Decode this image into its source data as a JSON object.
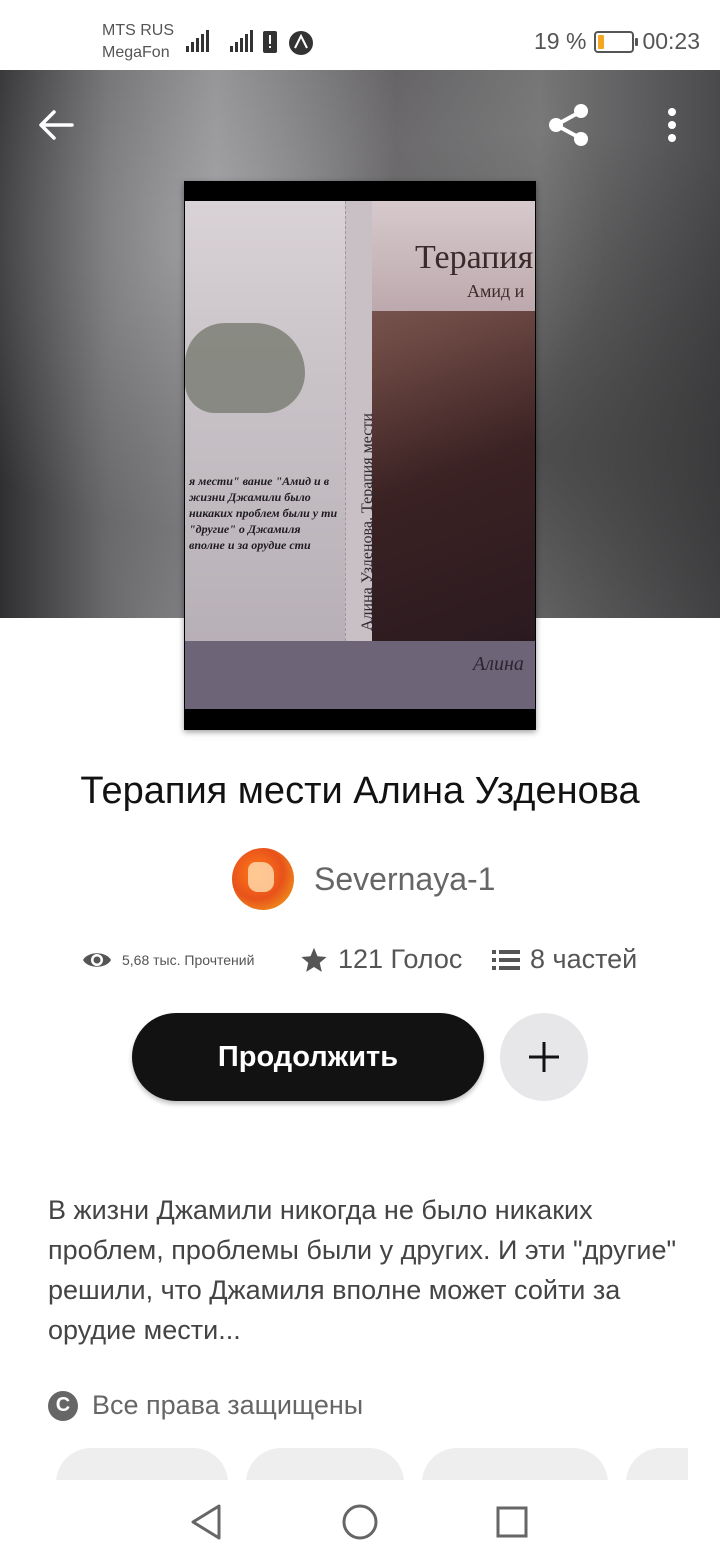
{
  "status_bar": {
    "carrier_1": "MTS RUS",
    "carrier_2": "MegaFon",
    "battery_percent": "19 %",
    "time": "00:23",
    "battery_level": 0.19
  },
  "book": {
    "title": "Терапия мести Алина Узденова",
    "author": "Severnaya-1",
    "cover": {
      "title": "Терапия",
      "subtitle": "Амид и",
      "spine": "Алина Узденова. Терапия мести",
      "author": "Алина",
      "snippet": "я мести\" вание \"Амид и в жизни Джамили было никаких проблем были у ти \"другие\" о Джамиля вполне и за орудие сти"
    }
  },
  "stats": {
    "reads": "5,68 тыс. Прочтений",
    "votes": "121 Голос",
    "parts": "8 частей"
  },
  "actions": {
    "continue_label": "Продолжить",
    "add_label": "+"
  },
  "description": "В жизни Джамили никогда не было никаких проблем, проблемы были у других. И эти \"другие\" решили, что Джамиля вполне может сойти за орудие мести...",
  "rights": "Все права защищены",
  "icons": {
    "back": "back-arrow-icon",
    "share": "share-icon",
    "more": "more-vertical-icon",
    "eye": "eye-icon",
    "star": "star-icon",
    "list": "list-icon",
    "copyright": "copyright-icon"
  },
  "colors": {
    "primary_button": "#121212",
    "add_button": "#e7e6e8",
    "battery": "#f5a623"
  }
}
